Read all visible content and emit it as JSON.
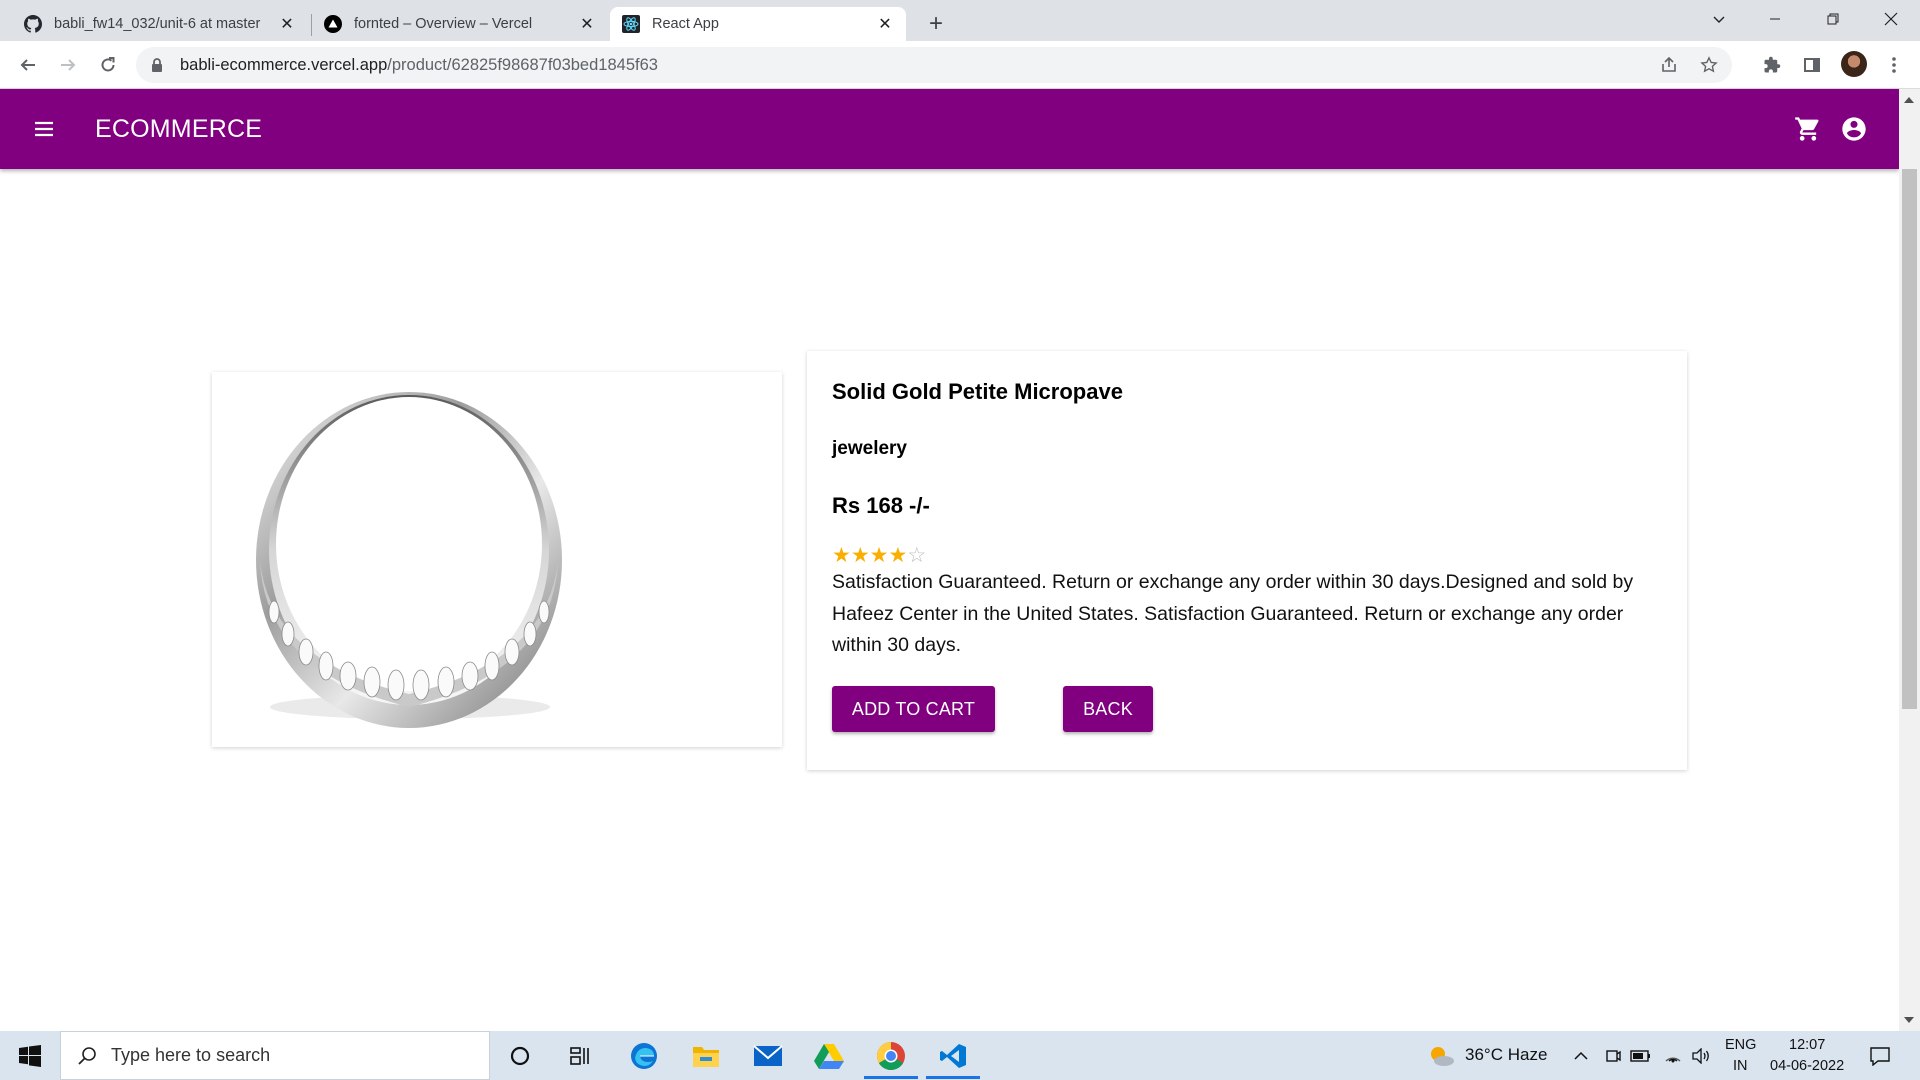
{
  "browser": {
    "tabs": [
      {
        "title": "babli_fw14_032/unit-6 at master",
        "favicon": "github-icon",
        "active": false
      },
      {
        "title": "fornted – Overview – Vercel",
        "favicon": "vercel-icon",
        "active": false
      },
      {
        "title": "React App",
        "favicon": "react-icon",
        "active": true
      }
    ],
    "address": {
      "host": "babli-ecommerce.vercel.app",
      "path": "/product/62825f98687f03bed1845f63"
    }
  },
  "appbar": {
    "brand": "ECOMMERCE",
    "background": "#800080"
  },
  "product": {
    "title": "Solid Gold Petite Micropave",
    "category": "jewelery",
    "price": "Rs 168 -/-",
    "rating": 4,
    "rating_max": 5,
    "description": "Satisfaction Guaranteed. Return or exchange any order within 30 days.Designed and sold by Hafeez Center in the United States. Satisfaction Guaranteed. Return or exchange any order within 30 days.",
    "add_to_cart_label": "ADD TO CART",
    "back_label": "BACK"
  },
  "taskbar": {
    "search_placeholder": "Type here to search",
    "weather": "36°C  Haze",
    "lang_top": "ENG",
    "lang_bottom": "IN",
    "time": "12:07",
    "date": "04-06-2022"
  }
}
